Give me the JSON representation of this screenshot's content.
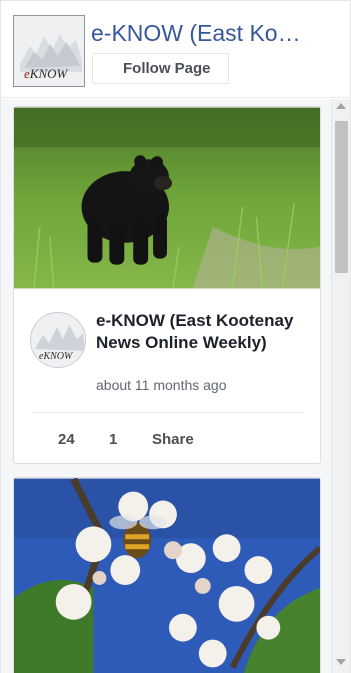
{
  "header": {
    "page_title": "e-KNOW (East Kootenay News Online Weekly)",
    "follow_label": "Follow Page",
    "logo_text": "eknow"
  },
  "posts": [
    {
      "author": "e-KNOW (East Kootenay News Online Weekly)",
      "time": "about 11 months ago",
      "likes": "24",
      "comments": "1",
      "share_label": "Share",
      "photo_icon": "black-bear-photo"
    },
    {
      "photo_icon": "bee-on-blossom-photo"
    }
  ],
  "colors": {
    "link_blue": "#365899",
    "text_dark": "#1d2129",
    "text_gray": "#606770",
    "border": "#dddfe2"
  }
}
